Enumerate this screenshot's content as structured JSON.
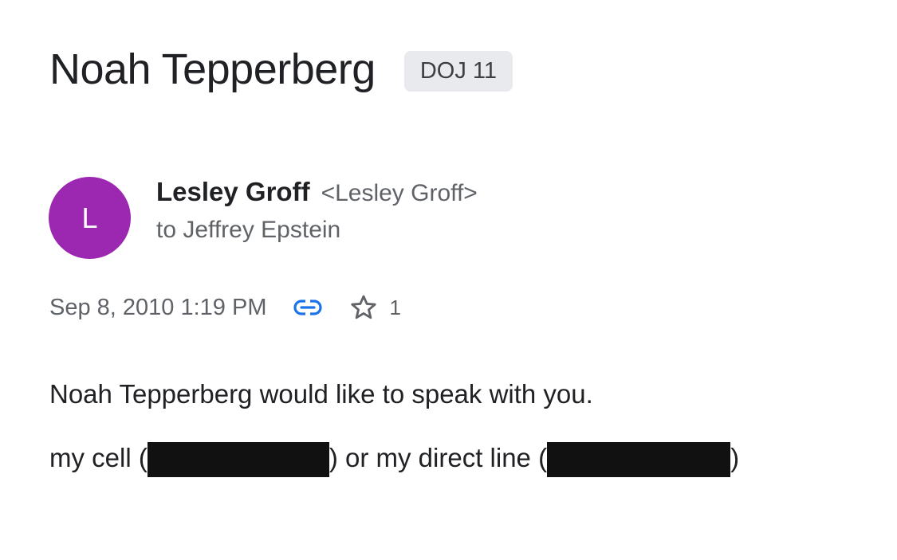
{
  "email": {
    "subject": "Noah Tepperberg",
    "label": "DOJ 11",
    "sender": {
      "avatar_letter": "L",
      "avatar_color": "#9c27b0",
      "name": "Lesley Groff",
      "email": "<Lesley Groff>"
    },
    "recipient_text": "to Jeffrey Epstein",
    "timestamp": "Sep 8, 2010 1:19 PM",
    "icons": {
      "link": "link-icon",
      "star": "star-outline-icon",
      "link_color": "#1a73e8"
    },
    "star_count": "1",
    "body": {
      "line1": "Noah Tepperberg would like to speak with you.",
      "line2_part1": "my cell (",
      "line2_part2": ") or my direct line (",
      "line2_part3": ")"
    }
  }
}
